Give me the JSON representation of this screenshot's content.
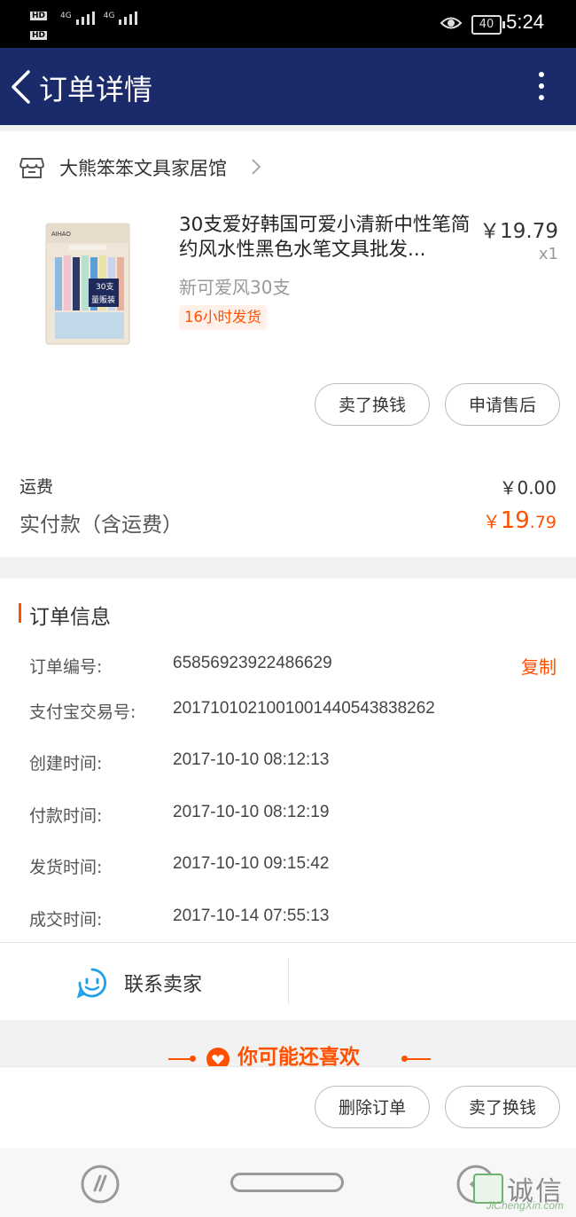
{
  "status": {
    "time": "5:24",
    "battery": "40",
    "network_1": "4G",
    "network_2": "4G",
    "hd_1": "HD",
    "hd_2": "HD"
  },
  "header": {
    "title": "订单详情"
  },
  "shop": {
    "name": "大熊笨笨文具家居馆"
  },
  "product": {
    "title": "30支爱好韩国可爱小清新中性笔简约风水性黑色水笔文具批发...",
    "price": "￥19.79",
    "quantity": "x1",
    "spec": "新可爱风30支",
    "badge": "16小时发货",
    "actions": {
      "sell": "卖了换钱",
      "after_sale": "申请售后"
    }
  },
  "fees": {
    "shipping_label": "运费",
    "shipping_value": "￥0.00",
    "paid_label": "实付款（含运费）",
    "paid_currency": "￥",
    "paid_int": "19",
    "paid_dec": ".79"
  },
  "order_info": {
    "title": "订单信息",
    "copy": "复制",
    "rows": [
      {
        "label": "订单编号:",
        "value": "65856923922486629"
      },
      {
        "label": "支付宝交易号:",
        "value": "2017101021001001440543838262"
      },
      {
        "label": "创建时间:",
        "value": "2017-10-10 08:12:13"
      },
      {
        "label": "付款时间:",
        "value": "2017-10-10 08:12:19"
      },
      {
        "label": "发货时间:",
        "value": "2017-10-10 09:15:42"
      },
      {
        "label": "成交时间:",
        "value": "2017-10-14 07:55:13"
      }
    ]
  },
  "contact": {
    "label": "联系卖家"
  },
  "recommend": {
    "title": "你可能还喜欢"
  },
  "bottom_actions": {
    "delete": "删除订单",
    "sell": "卖了换钱"
  },
  "package": {
    "brand": "AIHAO",
    "count": "30支",
    "label": "量贩装"
  },
  "watermark": {
    "text": "诚信",
    "url": "JiChengXin.com"
  },
  "colors": {
    "accent": "#ff5000",
    "navbar": "#1a2a6b"
  }
}
